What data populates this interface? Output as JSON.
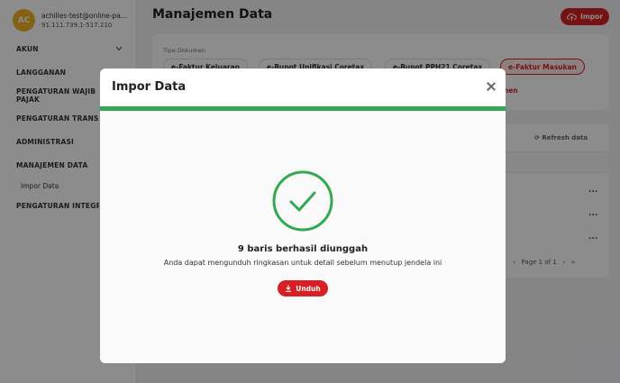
{
  "user": {
    "initials": "AC",
    "email": "achilles-test@online-pa...",
    "id": "91.111.739.1-517.210"
  },
  "nav": {
    "akun": "AKUN",
    "langganan": "LANGGANAN",
    "pengaturan_wajib_pajak": "PENGATURAN WAJIB PAJAK",
    "pengaturan_transaksi": "PENGATURAN TRANSAKSI",
    "administrasi": "ADMINISTRASI",
    "manajemen_data": "MANAJEMEN DATA",
    "impor_data": "Impor Data",
    "pengaturan_integrasi": "PENGATURAN INTEGRASI"
  },
  "page": {
    "title": "Manajemen Data",
    "impor_label": "Impor",
    "tipe_dokumen_label": "Tipe Dokumen",
    "chips": [
      "e-Faktur Keluaran",
      "e-Bupot Unifikasi Coretax",
      "e-Bupot PPH21 Coretax",
      "e-Faktur Masukan"
    ],
    "chip_under": "nen",
    "refresh_label": "Refresh data",
    "dots": "...",
    "pager": "Page 1 of 1"
  },
  "modal": {
    "title": "Impor Data",
    "progress": 1.0,
    "success_title": "9 baris berhasil diunggah",
    "success_sub": "Anda dapat mengunduh ringkasan untuk detail sebelum menutup jendela ini",
    "unduh_label": "Unduh"
  },
  "colors": {
    "accent": "#d71f26",
    "success": "#33a852",
    "avatar": "#f0b323"
  }
}
